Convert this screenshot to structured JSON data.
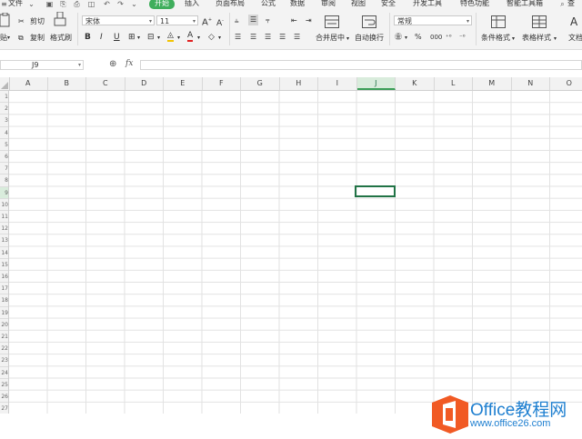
{
  "menu": {
    "file": "文件",
    "tabs": [
      "开始",
      "插入",
      "页面布局",
      "公式",
      "数据",
      "审阅",
      "视图",
      "安全",
      "开发工具",
      "特色功能",
      "智能工具箱"
    ],
    "active_tab": "开始"
  },
  "ribbon": {
    "paste": "贴",
    "cut": "剪切",
    "copy": "复制",
    "format_painter": "格式刷",
    "font_name": "宋体",
    "font_size": "11",
    "bold": "B",
    "italic": "I",
    "underline": "U",
    "merge_center": "合并居中",
    "wrap_text": "自动换行",
    "number_format": "常规",
    "percent": "%",
    "thousands": "000",
    "conditional_format": "条件格式",
    "table_style": "表格样式",
    "text_tool": "文档"
  },
  "formula_bar": {
    "name_box": "J9",
    "fx": "fx",
    "value": ""
  },
  "grid": {
    "columns": [
      "A",
      "B",
      "C",
      "D",
      "E",
      "F",
      "G",
      "H",
      "I",
      "J",
      "K",
      "L",
      "M",
      "N",
      "O"
    ],
    "selected_column": "J",
    "rows": [
      "1",
      "2",
      "3",
      "4",
      "5",
      "6",
      "7",
      "8",
      "9",
      "10",
      "11",
      "12",
      "13",
      "14",
      "15",
      "16",
      "17",
      "18",
      "19",
      "20",
      "21",
      "22",
      "23",
      "24",
      "25",
      "26",
      "27"
    ]
  },
  "watermark": {
    "name": "Office教程网",
    "url": "www.office26.com",
    "accent": "#f15a24",
    "text_color": "#1e7fd0"
  }
}
